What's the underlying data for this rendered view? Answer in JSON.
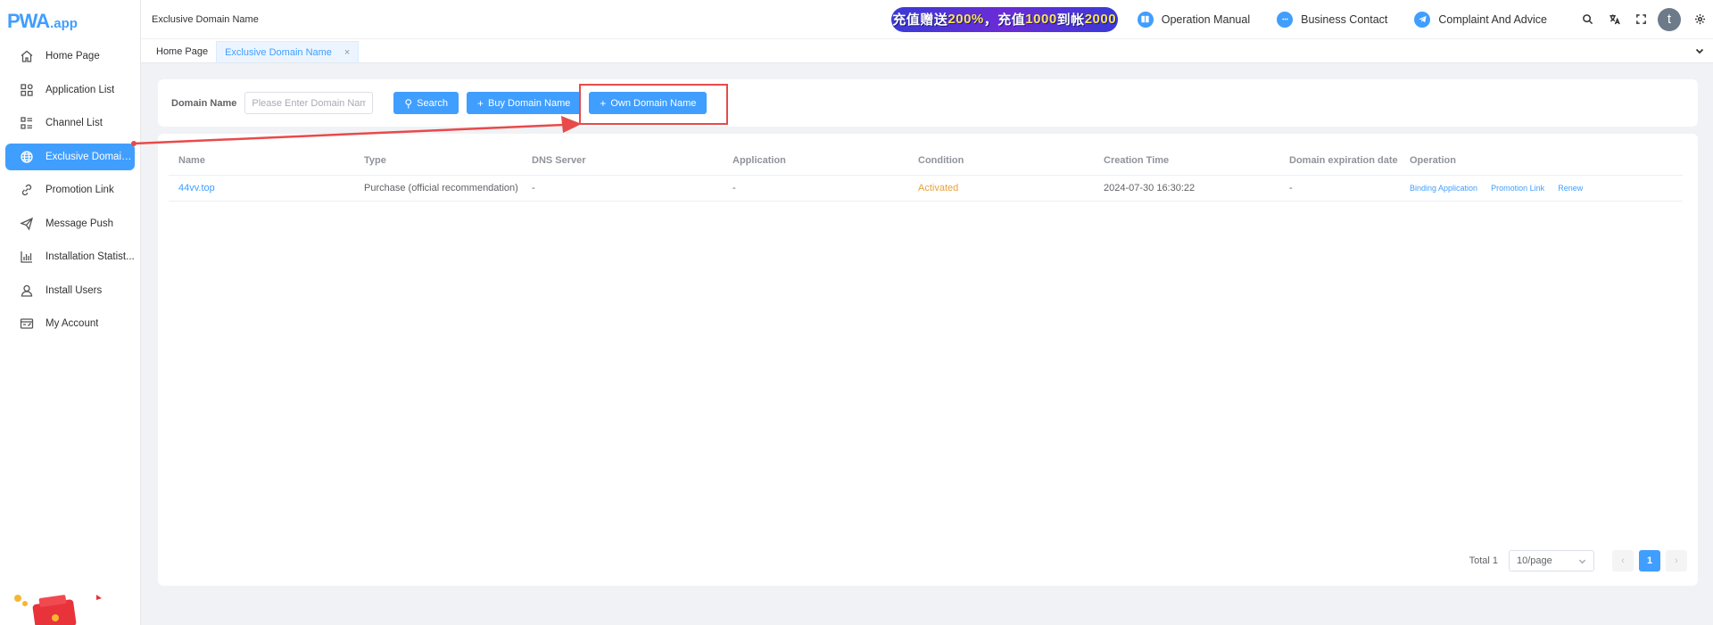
{
  "app": {
    "logo_mark": "PWA",
    "logo_suffix": ".app"
  },
  "sidebar": {
    "items": [
      {
        "label": "Home Page",
        "icon": "home-icon",
        "active": false
      },
      {
        "label": "Application List",
        "icon": "grid-icon",
        "active": false
      },
      {
        "label": "Channel List",
        "icon": "list-icon",
        "active": false
      },
      {
        "label": "Exclusive Domain...",
        "icon": "globe-icon",
        "active": true
      },
      {
        "label": "Promotion Link",
        "icon": "link-icon",
        "active": false
      },
      {
        "label": "Message Push",
        "icon": "send-icon",
        "active": false
      },
      {
        "label": "Installation Statist...",
        "icon": "bar-chart-icon",
        "active": false
      },
      {
        "label": "Install Users",
        "icon": "user-icon",
        "active": false
      },
      {
        "label": "My Account",
        "icon": "account-card-icon",
        "active": false
      }
    ]
  },
  "header": {
    "title": "Exclusive Domain Name",
    "banner": {
      "part1": "充值赠送",
      "pct": "200%",
      "part2": "，充值",
      "amt1": "1000",
      "part3": "到帐",
      "amt2": "2000"
    },
    "links": {
      "manual": "Operation Manual",
      "contact": "Business Contact",
      "complaint": "Complaint And Advice"
    },
    "avatar_letter": "t"
  },
  "tabs": [
    {
      "label": "Home Page",
      "active": false
    },
    {
      "label": "Exclusive Domain Name",
      "active": true,
      "close": "×"
    }
  ],
  "filter": {
    "label": "Domain Name",
    "placeholder": "Please Enter Domain Name",
    "search_label": "Search",
    "buy_label": "Buy Domain Name",
    "own_label": "Own Domain Name"
  },
  "table": {
    "columns": [
      "Name",
      "Type",
      "DNS Server",
      "Application",
      "Condition",
      "Creation Time",
      "Domain expiration date",
      "Operation"
    ],
    "rows": [
      {
        "name": "44vv.top",
        "type": "Purchase (official recommendation)",
        "dns": "-",
        "application": "-",
        "condition": "Activated",
        "created": "2024-07-30 16:30:22",
        "expires": "-",
        "ops": [
          "Binding Application",
          "Promotion Link",
          "Renew"
        ]
      }
    ]
  },
  "pager": {
    "total": "Total 1",
    "page_size": "10/page",
    "current": "1"
  },
  "colors": {
    "primary": "#409eff",
    "warning": "#e6a23c",
    "annotation": "#e84a4a"
  }
}
